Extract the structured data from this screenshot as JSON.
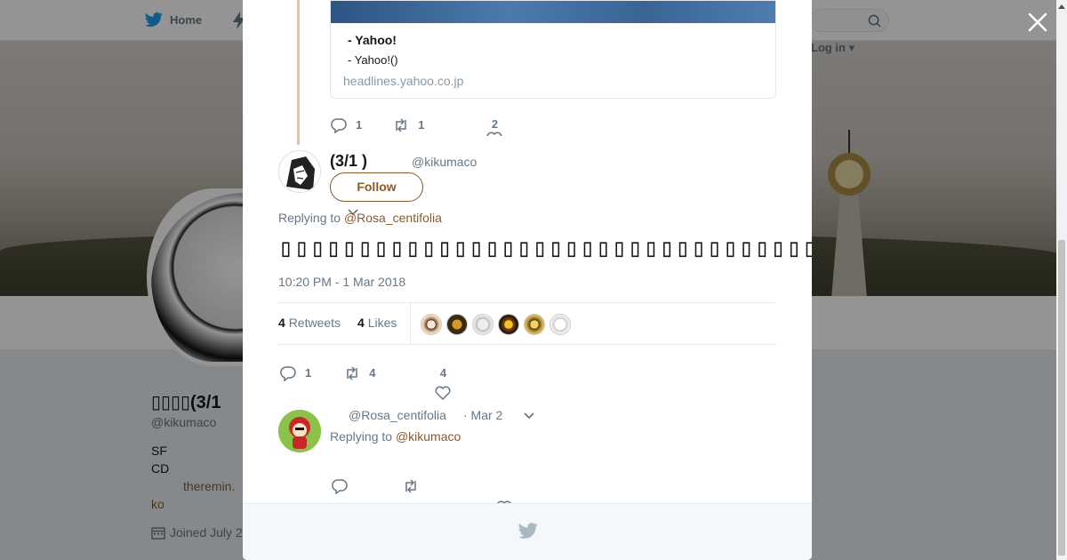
{
  "background_page": {
    "nav_home_label": "Home",
    "nav_login_label": "Log in",
    "profile_name": "▯▯▯▯(3/1",
    "profile_handle": "@kikumaco",
    "bio_line1": "SF",
    "bio_line2": "CD",
    "bio_link": "theremin.",
    "bio_ko": "ko",
    "joined": "Joined July 2"
  },
  "thread_card": {
    "title": "- Yahoo!",
    "description": "- Yahoo!()",
    "domain": "headlines.yahoo.co.jp",
    "reply_count": "1",
    "retweet_count": "1",
    "like_count": "2"
  },
  "main_tweet": {
    "author_name": "(3/1 )",
    "author_handle": "@kikumaco",
    "follow_label": "Follow",
    "replying_prefix": "Replying to ",
    "replying_to": "@Rosa_centifolia",
    "text": "▯▯▯▯▯▯▯▯▯▯▯▯▯▯▯▯▯▯▯▯▯▯▯▯▯▯▯▯▯▯▯▯▯▯▯▯▯▯▯",
    "timestamp": "10:20 PM - 1 Mar 2018",
    "retweets_count": "4",
    "retweets_label": "Retweets",
    "likes_count": "4",
    "likes_label": "Likes",
    "reply_count": "1",
    "retweet_count": "4",
    "like_count": "4"
  },
  "reply_tweet": {
    "handle": "@Rosa_centifolia",
    "date": "· Mar 2",
    "replying_prefix": "Replying to ",
    "replying_to": "@kikumaco"
  },
  "colors": {
    "accent": "#8b5a2b",
    "thread_line": "#e0c3a8",
    "text_secondary": "#657786"
  },
  "icons": [
    "twitter-bird-icon",
    "close-icon",
    "reply-icon",
    "retweet-icon",
    "heart-icon",
    "chevron-down-icon",
    "calendar-icon",
    "search-icon"
  ]
}
